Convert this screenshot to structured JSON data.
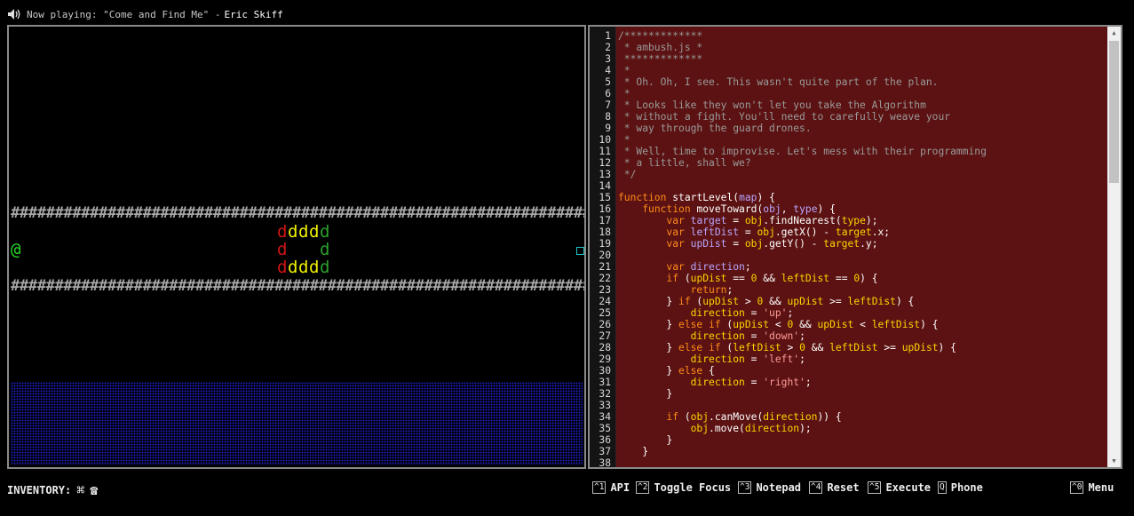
{
  "now_playing": {
    "prefix": "Now playing: \"Come and Find Me\" - ",
    "artist": "Eric Skiff"
  },
  "game": {
    "wall_top": "################################################################################",
    "wall_bottom": "################################################################################",
    "player_glyph": "@",
    "drone_glyph": "d"
  },
  "editor": {
    "lines": [
      {
        "n": "1",
        "html": "<span class=\"cm\">/*************</span>"
      },
      {
        "n": "2",
        "html": "<span class=\"cm\"> * ambush.js *</span>"
      },
      {
        "n": "3",
        "html": "<span class=\"cm\"> *************</span>"
      },
      {
        "n": "4",
        "html": "<span class=\"cm\"> *</span>"
      },
      {
        "n": "5",
        "html": "<span class=\"cm\"> * Oh. Oh, I see. This wasn't quite part of the plan.</span>"
      },
      {
        "n": "6",
        "html": "<span class=\"cm\"> *</span>"
      },
      {
        "n": "7",
        "html": "<span class=\"cm\"> * Looks like they won't let you take the Algorithm</span>"
      },
      {
        "n": "8",
        "html": "<span class=\"cm\"> * without a fight. You'll need to carefully weave your</span>"
      },
      {
        "n": "9",
        "html": "<span class=\"cm\"> * way through the guard drones.</span>"
      },
      {
        "n": "10",
        "html": "<span class=\"cm\"> *</span>"
      },
      {
        "n": "11",
        "html": "<span class=\"cm\"> * Well, time to improvise. Let's mess with their programming</span>"
      },
      {
        "n": "12",
        "html": "<span class=\"cm\"> * a little, shall we?</span>"
      },
      {
        "n": "13",
        "html": "<span class=\"cm\"> */</span>"
      },
      {
        "n": "14",
        "html": ""
      },
      {
        "n": "15",
        "html": "<span class=\"kw\">function</span> <span class=\"df\">startLevel</span>(<span class=\"pr\">map</span>) {"
      },
      {
        "n": "16",
        "html": "    <span class=\"kw\">function</span> <span class=\"df\">moveToward</span>(<span class=\"pr\">obj</span>, <span class=\"pr\">type</span>) {"
      },
      {
        "n": "17",
        "html": "        <span class=\"kw\">var</span> <span class=\"pr\">target</span> = <span class=\"vr\">obj</span>.findNearest(<span class=\"vr\">type</span>);"
      },
      {
        "n": "18",
        "html": "        <span class=\"kw\">var</span> <span class=\"pr\">leftDist</span> = <span class=\"vr\">obj</span>.getX() - <span class=\"vr\">target</span>.x;"
      },
      {
        "n": "19",
        "html": "        <span class=\"kw\">var</span> <span class=\"pr\">upDist</span> = <span class=\"vr\">obj</span>.getY() - <span class=\"vr\">target</span>.y;"
      },
      {
        "n": "20",
        "html": ""
      },
      {
        "n": "21",
        "html": "        <span class=\"kw\">var</span> <span class=\"pr\">direction</span>;"
      },
      {
        "n": "22",
        "html": "        <span class=\"kw\">if</span> (<span class=\"vr\">upDist</span> == <span class=\"nm\">0</span> &amp;&amp; <span class=\"vr\">leftDist</span> == <span class=\"nm\">0</span>) {"
      },
      {
        "n": "23",
        "html": "            <span class=\"kw\">return</span>;"
      },
      {
        "n": "24",
        "html": "        } <span class=\"kw\">if</span> (<span class=\"vr\">upDist</span> &gt; <span class=\"nm\">0</span> &amp;&amp; <span class=\"vr\">upDist</span> &gt;= <span class=\"vr\">leftDist</span>) {"
      },
      {
        "n": "25",
        "html": "            <span class=\"vr\">direction</span> = <span class=\"st\">'up'</span>;"
      },
      {
        "n": "26",
        "html": "        } <span class=\"kw\">else if</span> (<span class=\"vr\">upDist</span> &lt; <span class=\"nm\">0</span> &amp;&amp; <span class=\"vr\">upDist</span> &lt; <span class=\"vr\">leftDist</span>) {"
      },
      {
        "n": "27",
        "html": "            <span class=\"vr\">direction</span> = <span class=\"st\">'down'</span>;"
      },
      {
        "n": "28",
        "html": "        } <span class=\"kw\">else if</span> (<span class=\"vr\">leftDist</span> &gt; <span class=\"nm\">0</span> &amp;&amp; <span class=\"vr\">leftDist</span> &gt;= <span class=\"vr\">upDist</span>) {"
      },
      {
        "n": "29",
        "html": "            <span class=\"vr\">direction</span> = <span class=\"st\">'left'</span>;"
      },
      {
        "n": "30",
        "html": "        } <span class=\"kw\">else</span> {"
      },
      {
        "n": "31",
        "html": "            <span class=\"vr\">direction</span> = <span class=\"st\">'right'</span>;"
      },
      {
        "n": "32",
        "html": "        }"
      },
      {
        "n": "33",
        "html": ""
      },
      {
        "n": "34",
        "html": "        <span class=\"kw\">if</span> (<span class=\"vr\">obj</span>.canMove(<span class=\"vr\">direction</span>)) {"
      },
      {
        "n": "35",
        "html": "            <span class=\"vr\">obj</span>.move(<span class=\"vr\">direction</span>);"
      },
      {
        "n": "36",
        "html": "        }"
      },
      {
        "n": "37",
        "html": "    }"
      },
      {
        "n": "38",
        "html": ""
      }
    ]
  },
  "bottom": {
    "inventory_label": "INVENTORY:",
    "inventory_icons": [
      "⌘",
      "☎"
    ],
    "hotkeys": [
      {
        "key": "^1",
        "label": "API"
      },
      {
        "key": "^2",
        "label": "Toggle Focus"
      },
      {
        "key": "^3",
        "label": "Notepad"
      },
      {
        "key": "^4",
        "label": "Reset"
      },
      {
        "key": "^5",
        "label": "Execute"
      },
      {
        "key": "Q",
        "label": "Phone"
      },
      {
        "key": "^0",
        "label": "Menu"
      }
    ]
  },
  "colors": {
    "editor_bg": "#5c1212",
    "drone_red": "#d21414",
    "drone_yellow": "#f0f000",
    "drone_green": "#2aa02a",
    "player": "#2adb2a",
    "exit": "#1ec8c8",
    "water": "#1c1cb8"
  }
}
